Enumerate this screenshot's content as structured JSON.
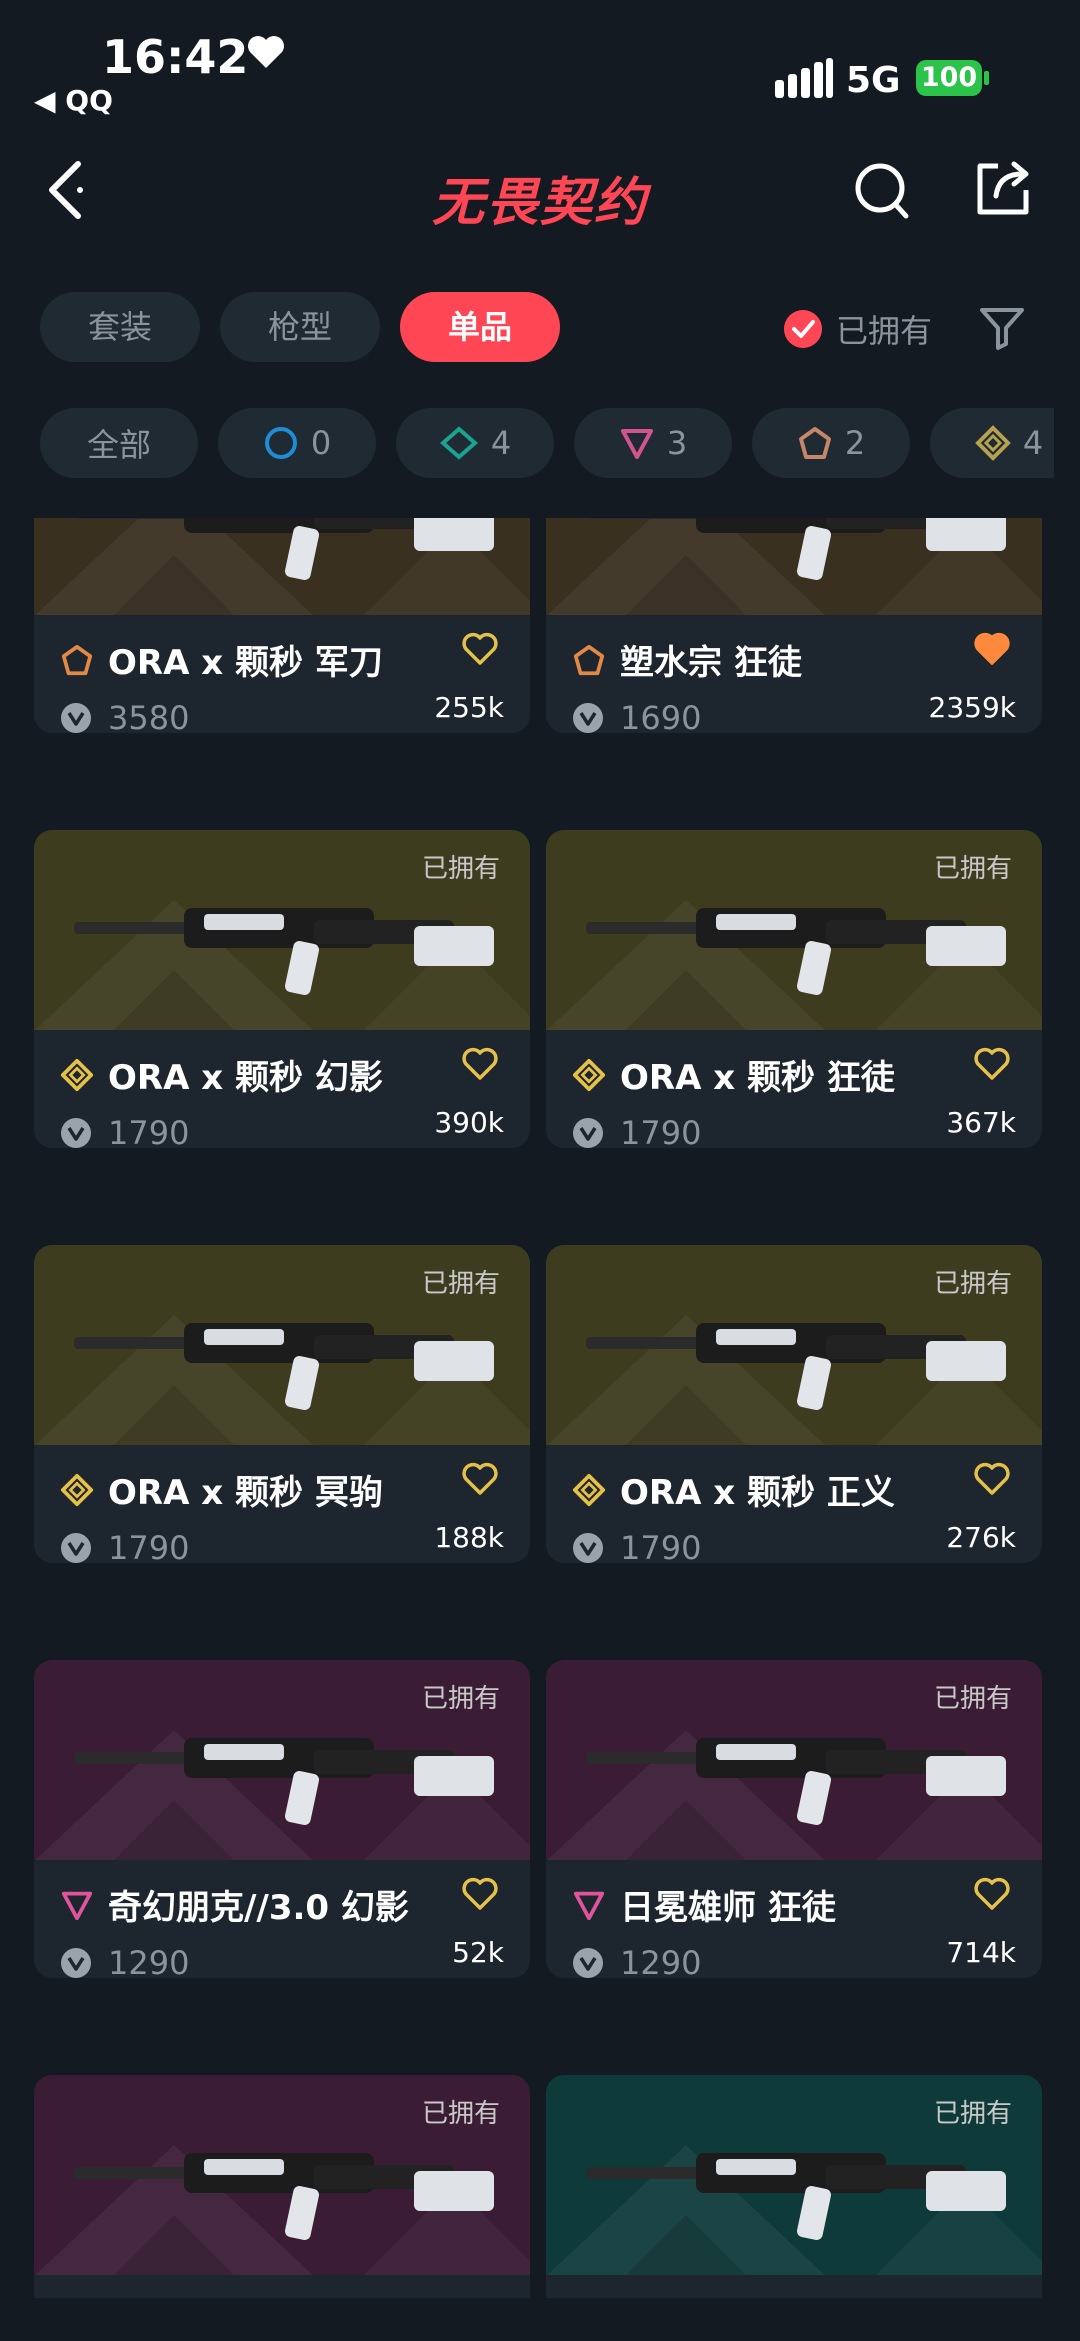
{
  "status_bar": {
    "time": "16:42",
    "back_app": "◀ QQ",
    "network": "5G",
    "battery": "100"
  },
  "header": {
    "title": "无畏契约",
    "icons": [
      "back-arrow-icon",
      "search-icon",
      "share-icon"
    ]
  },
  "tabs": [
    {
      "label": "套装",
      "active": false
    },
    {
      "label": "枪型",
      "active": false
    },
    {
      "label": "单品",
      "active": true
    }
  ],
  "owned_filter": {
    "label": "已拥有",
    "checked": true
  },
  "rarity_filters": [
    {
      "label": "全部",
      "icon": null,
      "color": null
    },
    {
      "label": "0",
      "icon": "select-tier-icon",
      "color": "#1f8cd6"
    },
    {
      "label": "4",
      "icon": "deluxe-tier-icon",
      "color": "#1aa38f"
    },
    {
      "label": "3",
      "icon": "premium-tier-icon",
      "color": "#d1548e"
    },
    {
      "label": "2",
      "icon": "exclusive-tier-icon",
      "color": "#c5876a"
    },
    {
      "label": "4",
      "icon": "ultra-tier-icon",
      "color": "#b6a24e"
    }
  ],
  "skins": [
    {
      "name": "ORA x 颗秒 军刀",
      "price": "3580",
      "likes": "255k",
      "owned": "",
      "tier_color": "#e08a46",
      "tier_icon": "exclusive-tier-icon",
      "bg": "#3a3020",
      "favorited": false
    },
    {
      "name": "塑水宗 狂徒",
      "price": "1690",
      "likes": "2359k",
      "owned": "",
      "tier_color": "#e08a46",
      "tier_icon": "exclusive-tier-icon",
      "bg": "#3a3020",
      "favorited": true
    },
    {
      "name": "ORA x 颗秒 幻影",
      "price": "1790",
      "likes": "390k",
      "owned": "已拥有",
      "tier_color": "#e5c14a",
      "tier_icon": "ultra-tier-icon",
      "bg": "#3e3c1e",
      "favorited": false
    },
    {
      "name": "ORA x 颗秒 狂徒",
      "price": "1790",
      "likes": "367k",
      "owned": "已拥有",
      "tier_color": "#e5c14a",
      "tier_icon": "ultra-tier-icon",
      "bg": "#3e3c1e",
      "favorited": false
    },
    {
      "name": "ORA x 颗秒 冥驹",
      "price": "1790",
      "likes": "188k",
      "owned": "已拥有",
      "tier_color": "#e5c14a",
      "tier_icon": "ultra-tier-icon",
      "bg": "#3e3c1e",
      "favorited": false
    },
    {
      "name": "ORA x 颗秒 正义",
      "price": "1790",
      "likes": "276k",
      "owned": "已拥有",
      "tier_color": "#e5c14a",
      "tier_icon": "ultra-tier-icon",
      "bg": "#3e3c1e",
      "favorited": false
    },
    {
      "name": "奇幻朋克//3.0 幻影",
      "price": "1290",
      "likes": "52k",
      "owned": "已拥有",
      "tier_color": "#e0559a",
      "tier_icon": "premium-tier-icon",
      "bg": "#3a1d35",
      "favorited": false
    },
    {
      "name": "日冕雄师 狂徒",
      "price": "1290",
      "likes": "714k",
      "owned": "已拥有",
      "tier_color": "#e0559a",
      "tier_icon": "premium-tier-icon",
      "bg": "#3a1d35",
      "favorited": false
    },
    {
      "name": "",
      "price": "",
      "likes": "",
      "owned": "已拥有",
      "tier_color": "#e0559a",
      "tier_icon": "premium-tier-icon",
      "bg": "#3a1d35",
      "favorited": false
    },
    {
      "name": "",
      "price": "",
      "likes": "",
      "owned": "已拥有",
      "tier_color": "#1aa38f",
      "tier_icon": "deluxe-tier-icon",
      "bg": "#0f3a3a",
      "favorited": false
    }
  ]
}
